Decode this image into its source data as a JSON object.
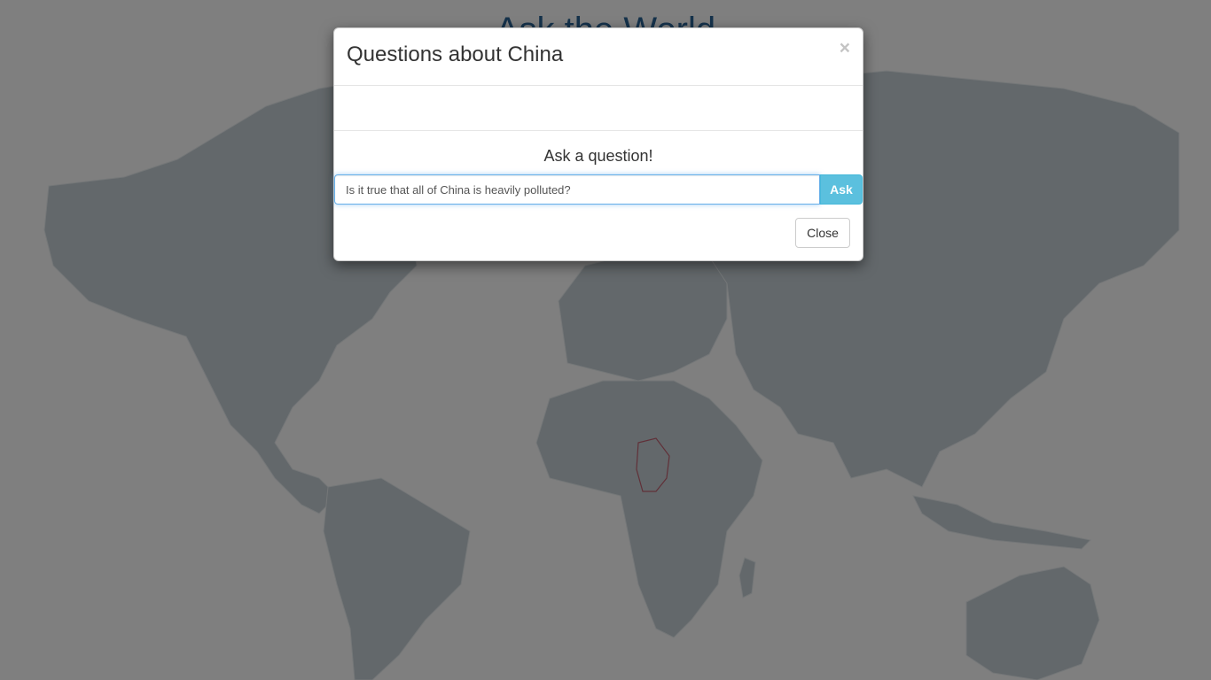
{
  "page": {
    "title": "Ask the World"
  },
  "map": {
    "land_color": "#c7d0d6",
    "border_color": "#e9eef1",
    "highlight_color": "#c06070"
  },
  "modal": {
    "title": "Questions about China",
    "close_icon": "×",
    "body_text": "",
    "ask_heading": "Ask a question!",
    "question_input": {
      "value": "Is it true that all of China is heavily polluted?",
      "placeholder": ""
    },
    "ask_button_label": "Ask",
    "close_button_label": "Close"
  },
  "colors": {
    "ask_button": "#5bc0de",
    "backdrop": "rgba(0,0,0,0.5)"
  }
}
